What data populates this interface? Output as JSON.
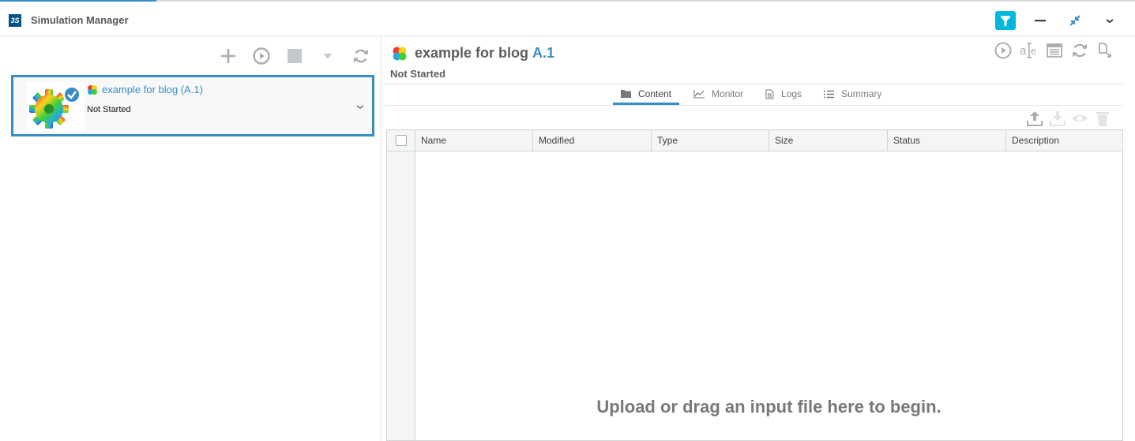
{
  "app": {
    "title": "Simulation Manager",
    "logo_text": "3S",
    "accent_color": "#368ec4",
    "filter_color": "#00b8de"
  },
  "header": {
    "icons": [
      "filter-icon",
      "minimize-icon",
      "collapse-icon",
      "chevron-down-icon"
    ]
  },
  "left_toolbar": {
    "icons": [
      "add-icon",
      "play-icon",
      "stop-icon",
      "dropdown-icon",
      "refresh-icon"
    ]
  },
  "simulation_card": {
    "title": "example for blog (A.1)",
    "status": "Not Started",
    "selected": true
  },
  "detail": {
    "title": "example for blog",
    "revision": "A.1",
    "status": "Not Started",
    "toolbar_icons": [
      "run-icon",
      "attributes-icon",
      "table-view-icon",
      "sync-icon",
      "share-icon"
    ]
  },
  "tabs": [
    {
      "label": "Content",
      "icon": "folder-icon",
      "active": true
    },
    {
      "label": "Monitor",
      "icon": "chart-icon",
      "active": false
    },
    {
      "label": "Logs",
      "icon": "document-icon",
      "active": false
    },
    {
      "label": "Summary",
      "icon": "list-icon",
      "active": false
    }
  ],
  "content_actions": [
    "upload-icon",
    "download-icon",
    "view-icon",
    "delete-icon"
  ],
  "table": {
    "columns": [
      "Name",
      "Modified",
      "Type",
      "Size",
      "Status",
      "Description"
    ],
    "rows": [],
    "empty_message": "Upload or drag an input file here to begin."
  }
}
